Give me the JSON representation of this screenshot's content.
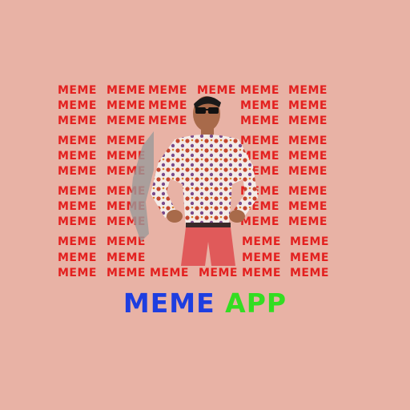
{
  "background_color": "#e8b2a5",
  "pattern": {
    "word": "MEME",
    "color": "#e3201f"
  },
  "figure": {
    "icon": "person-sunglasses-figure",
    "shirt_color": "#f4ece8",
    "pants_color": "#e05a5a"
  },
  "title": {
    "word1": "MEME",
    "word2": "APP",
    "word1_color": "#1e3ee0",
    "word2_color": "#33dd22"
  }
}
